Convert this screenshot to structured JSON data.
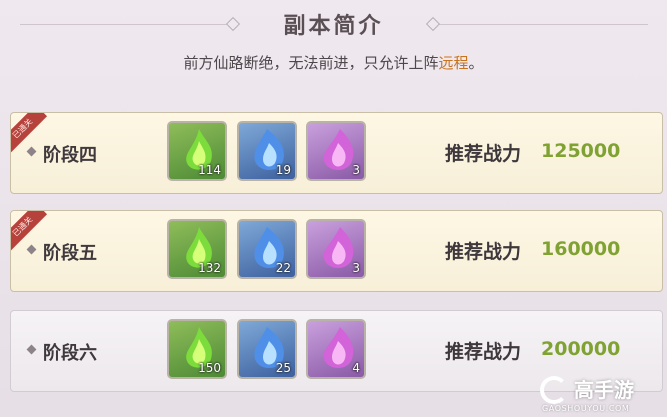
{
  "header": {
    "title": "副本简介",
    "description_prefix": "前方仙路断绝，无法前进，只允许上阵",
    "description_highlight": "远程",
    "description_suffix": "。"
  },
  "stages": [
    {
      "name": "阶段四",
      "cleared_badge": "已通关",
      "items": [
        {
          "icon": "green-spirit-flame-icon",
          "count": "114"
        },
        {
          "icon": "blue-spirit-flame-icon",
          "count": "19"
        },
        {
          "icon": "purple-spirit-flame-icon",
          "count": "3"
        }
      ],
      "power_label": "推荐战力",
      "power_value": "125000"
    },
    {
      "name": "阶段五",
      "cleared_badge": "已通关",
      "items": [
        {
          "icon": "green-spirit-flame-icon",
          "count": "132"
        },
        {
          "icon": "blue-spirit-flame-icon",
          "count": "22"
        },
        {
          "icon": "purple-spirit-flame-icon",
          "count": "3"
        }
      ],
      "power_label": "推荐战力",
      "power_value": "160000"
    },
    {
      "name": "阶段六",
      "items": [
        {
          "icon": "green-spirit-flame-icon",
          "count": "150"
        },
        {
          "icon": "blue-spirit-flame-icon",
          "count": "25"
        },
        {
          "icon": "purple-spirit-flame-icon",
          "count": "4"
        }
      ],
      "power_label": "推荐战力",
      "power_value": "200000"
    }
  ],
  "watermark": {
    "brand": "高手游",
    "url": "GAOSHOUYOU.COM"
  },
  "colors": {
    "highlight": "#c9721e",
    "power_value": "#7fa233",
    "ribbon": "#b7413b"
  }
}
